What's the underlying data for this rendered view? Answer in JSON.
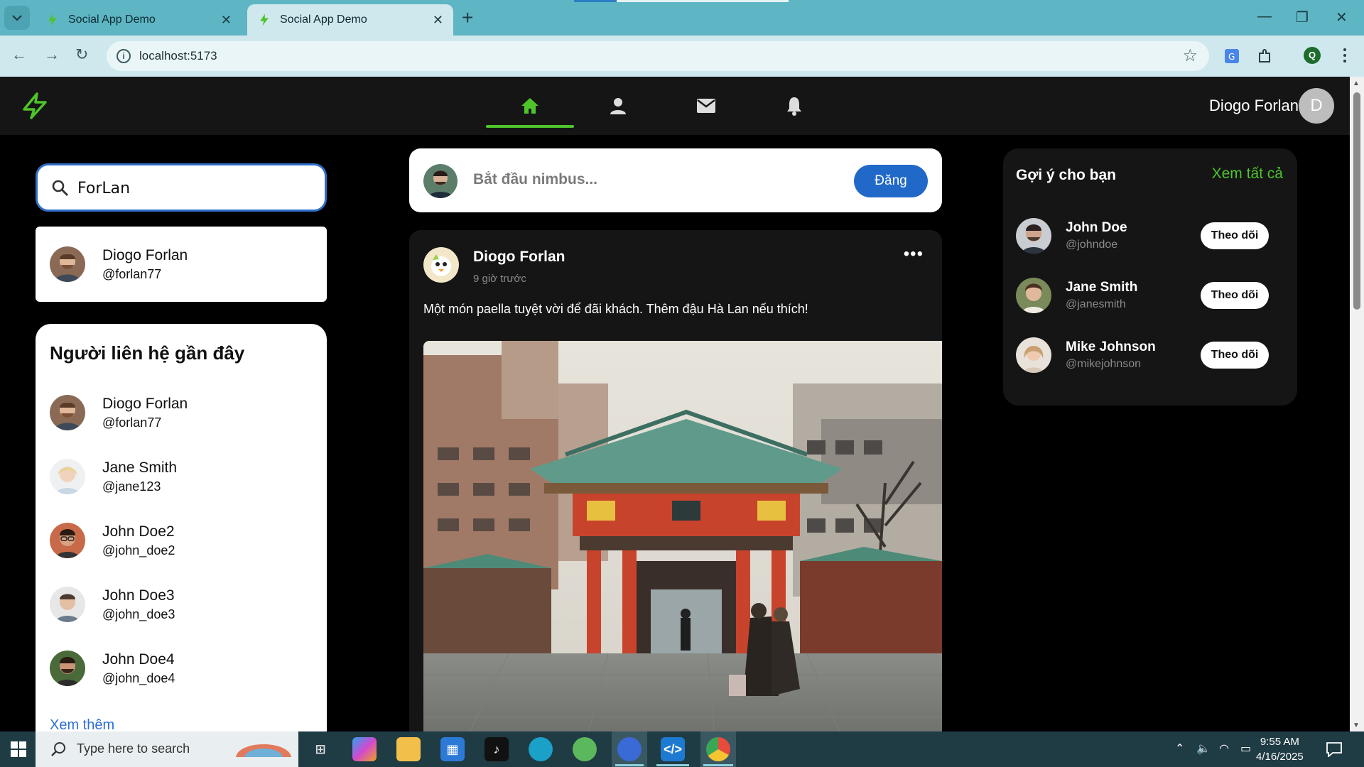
{
  "browser": {
    "tabs": [
      {
        "title": "Social App Demo",
        "active": false
      },
      {
        "title": "Social App Demo",
        "active": true
      }
    ],
    "url": "localhost:5173",
    "profile_initial": "Q"
  },
  "app": {
    "nav": {
      "user_name": "Diogo Forlan",
      "user_initial": "D",
      "accent_color": "#4ec42a"
    },
    "search": {
      "value": "ForLan",
      "results": [
        {
          "name": "Diogo Forlan",
          "handle": "@forlan77"
        }
      ]
    },
    "contacts": {
      "title": "Người liên hệ gần đây",
      "items": [
        {
          "name": "Diogo Forlan",
          "handle": "@forlan77"
        },
        {
          "name": "Jane Smith",
          "handle": "@jane123"
        },
        {
          "name": "John Doe2",
          "handle": "@john_doe2"
        },
        {
          "name": "John Doe3",
          "handle": "@john_doe3"
        },
        {
          "name": "John Doe4",
          "handle": "@john_doe4"
        }
      ],
      "see_more": "Xem thêm"
    },
    "composer": {
      "placeholder": "Bắt đầu nimbus...",
      "post_label": "Đăng"
    },
    "post": {
      "author": "Diogo Forlan",
      "time": "9 giờ trước",
      "content": "Một món paella tuyệt vời để đãi khách. Thêm đậu Hà Lan nếu thích!",
      "more": "•••"
    },
    "suggestions": {
      "title": "Gợi ý cho bạn",
      "view_all": "Xem tất cả",
      "follow_label": "Theo dõi",
      "items": [
        {
          "name": "John Doe",
          "handle": "@johndoe"
        },
        {
          "name": "Jane Smith",
          "handle": "@janesmith"
        },
        {
          "name": "Mike Johnson",
          "handle": "@mikejohnson"
        }
      ]
    }
  },
  "taskbar": {
    "search_placeholder": "Type here to search",
    "time": "9:55 AM",
    "date": "4/16/2025"
  }
}
